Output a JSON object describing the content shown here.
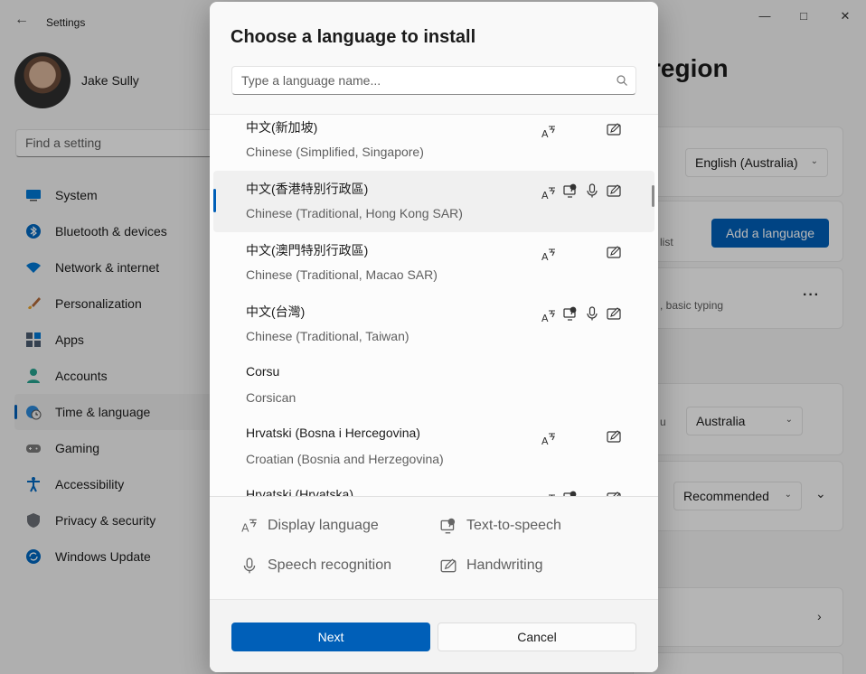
{
  "app": {
    "title": "Settings"
  },
  "profile": {
    "name": "Jake Sully"
  },
  "search_settings": {
    "placeholder": "Find a setting"
  },
  "nav": [
    {
      "label": "System",
      "icon": "monitor-icon"
    },
    {
      "label": "Bluetooth & devices",
      "icon": "bluetooth-icon"
    },
    {
      "label": "Network & internet",
      "icon": "wifi-icon"
    },
    {
      "label": "Personalization",
      "icon": "brush-icon"
    },
    {
      "label": "Apps",
      "icon": "apps-icon"
    },
    {
      "label": "Accounts",
      "icon": "person-icon"
    },
    {
      "label": "Time & language",
      "icon": "globe-clock-icon",
      "active": true
    },
    {
      "label": "Gaming",
      "icon": "gamepad-icon"
    },
    {
      "label": "Accessibility",
      "icon": "accessibility-icon"
    },
    {
      "label": "Privacy & security",
      "icon": "shield-icon"
    },
    {
      "label": "Windows Update",
      "icon": "update-icon"
    }
  ],
  "background_page": {
    "heading_fragment": "region",
    "display_language_value": "English (Australia)",
    "add_language_label": "Add a language",
    "list_fragment": "list",
    "typing_fragment": ", basic typing",
    "country_fragment": "u",
    "country_value": "Australia",
    "format_value": "Recommended"
  },
  "dialog": {
    "title": "Choose a language to install",
    "search_placeholder": "Type a language name...",
    "languages": [
      {
        "native": "中文(新加坡)",
        "english": "Chinese (Simplified, Singapore)",
        "features": [
          "display",
          "handwriting"
        ]
      },
      {
        "native": "中文(香港特別行政區)",
        "english": "Chinese (Traditional, Hong Kong SAR)",
        "features": [
          "display",
          "tts",
          "speech",
          "handwriting"
        ],
        "selected": true
      },
      {
        "native": "中文(澳門特別行政區)",
        "english": "Chinese (Traditional, Macao SAR)",
        "features": [
          "display",
          "handwriting"
        ]
      },
      {
        "native": "中文(台灣)",
        "english": "Chinese (Traditional, Taiwan)",
        "features": [
          "display",
          "tts",
          "speech",
          "handwriting"
        ]
      },
      {
        "native": "Corsu",
        "english": "Corsican",
        "features": []
      },
      {
        "native": "Hrvatski (Bosna i Hercegovina)",
        "english": "Croatian (Bosnia and Herzegovina)",
        "features": [
          "display",
          "handwriting"
        ]
      },
      {
        "native": "Hrvatski (Hrvatska)",
        "english": "",
        "features": [
          "display",
          "tts",
          "handwriting"
        ]
      }
    ],
    "legend": {
      "display": "Display language",
      "tts": "Text-to-speech",
      "speech": "Speech recognition",
      "handwriting": "Handwriting"
    },
    "next_label": "Next",
    "cancel_label": "Cancel"
  },
  "colors": {
    "accent": "#005fb8"
  }
}
